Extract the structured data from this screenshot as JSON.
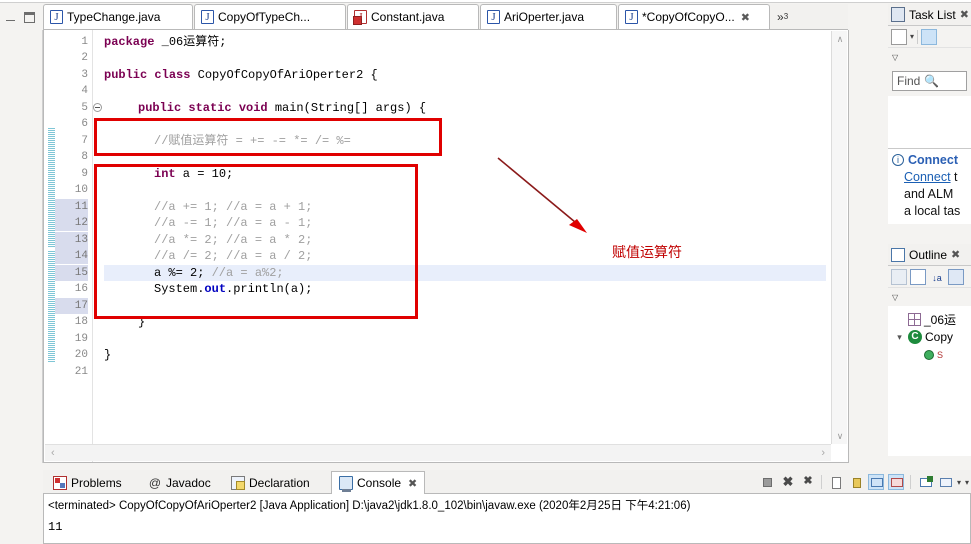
{
  "app": {
    "title": "Eclipse IDE - CopyOfCopyOfAriOperter2.java"
  },
  "editor_tabs": [
    {
      "label": "TypeChange.java",
      "icon": "java-file-icon",
      "active": false,
      "dirty": false,
      "error": false
    },
    {
      "label": "CopyOfTypeCh...",
      "icon": "java-file-icon",
      "active": false,
      "dirty": false,
      "error": false
    },
    {
      "label": "Constant.java",
      "icon": "java-file-error-icon",
      "active": false,
      "dirty": false,
      "error": true
    },
    {
      "label": "AriOperter.java",
      "icon": "java-file-icon",
      "active": false,
      "dirty": false,
      "error": false
    },
    {
      "label": "*CopyOfCopyO...",
      "icon": "java-file-icon",
      "active": true,
      "dirty": true,
      "error": false
    }
  ],
  "editor_tab_overflow": {
    "label": "»",
    "count": "3"
  },
  "window_controls": {
    "minimize": "minimize-icon",
    "maximize": "maximize-icon"
  },
  "code": {
    "line_numbers": [
      "1",
      "2",
      "3",
      "4",
      "5",
      "6",
      "7",
      "8",
      "9",
      "10",
      "11",
      "12",
      "13",
      "14",
      "15",
      "16",
      "17",
      "18",
      "19",
      "20",
      "21"
    ],
    "highlighted_line": "15",
    "lines": [
      {
        "n": "1",
        "text": "package _06运算符;"
      },
      {
        "n": "2",
        "text": ""
      },
      {
        "n": "3",
        "text": "public class CopyOfCopyOfAriOperter2 {"
      },
      {
        "n": "4",
        "text": ""
      },
      {
        "n": "5",
        "text": "    public static void main(String[] args) {"
      },
      {
        "n": "6",
        "text": ""
      },
      {
        "n": "7",
        "text": "        //赋值运算符 = += -= *= /= %="
      },
      {
        "n": "8",
        "text": ""
      },
      {
        "n": "9",
        "text": "        int a = 10;"
      },
      {
        "n": "10",
        "text": ""
      },
      {
        "n": "11",
        "text": "        //a += 1; //a = a + 1;"
      },
      {
        "n": "12",
        "text": "        //a -= 1; //a = a - 1;"
      },
      {
        "n": "13",
        "text": "        //a *= 2; //a = a * 2;"
      },
      {
        "n": "14",
        "text": "        //a /= 2; //a = a / 2;"
      },
      {
        "n": "15",
        "text": "        a %= 2; //a = a%2;"
      },
      {
        "n": "16",
        "text": "        System.out.println(a);"
      },
      {
        "n": "17",
        "text": ""
      },
      {
        "n": "18",
        "text": "    }"
      },
      {
        "n": "19",
        "text": ""
      },
      {
        "n": "20",
        "text": "}"
      },
      {
        "n": "21",
        "text": ""
      }
    ],
    "tokens": {
      "l1_kw": "package",
      "l1_rest": " _06运算符;",
      "l3_kw1": "public",
      "l3_kw2": "class",
      "l3_rest": " CopyOfCopyOfAriOperter2 {",
      "l5_kw": "public static void",
      "l5_rest": " main(String[] args) {",
      "l7_cmt": "//赋值运算符 = += -= *= /= %=",
      "l9_kw": "int",
      "l9_rest": " a = 10;",
      "l11_cmt": "//a += 1; //a = a + 1;",
      "l12_cmt": "//a -= 1; //a = a - 1;",
      "l13_cmt": "//a *= 2; //a = a * 2;",
      "l14_cmt": "//a /= 2; //a = a / 2;",
      "l15_code": "a %= 2; ",
      "l15_cmt": "//a = a%2;",
      "l16_a": "System.",
      "l16_b": "out",
      "l16_c": ".println(a);",
      "l18": "}",
      "l20": "}"
    }
  },
  "annotations": {
    "box1_label": "assignment-operator-comment-box",
    "box2_label": "assignment-operator-code-box",
    "arrow_label": "red-arrow",
    "text": "赋值运算符",
    "color": "#e00000"
  },
  "task_list": {
    "tab_label": "Task List",
    "close_icon": "✖",
    "find_placeholder": "Find",
    "search_icon": "search-icon",
    "new_task_icon": "new-task-icon",
    "categorize_icon": "categorize-icon",
    "menu_icon": "view-menu-icon",
    "connect_title": "Connect",
    "connect_link": "Connect",
    "connect_line1_rest": " t",
    "connect_line2": "and ALM",
    "connect_line3": "a local tas"
  },
  "outline": {
    "tab_label": "Outline",
    "close_icon": "✖",
    "items": [
      {
        "label": "_06运",
        "icon": "package-icon",
        "indent": 0,
        "expandable": false
      },
      {
        "label": "Copy",
        "icon": "class-icon",
        "indent": 0,
        "expandable": true,
        "expanded": true
      },
      {
        "label": "S",
        "icon": "method-icon",
        "indent": 1,
        "expandable": false
      }
    ],
    "toolbar_icons": [
      "sort-icon",
      "collapse-all-icon",
      "sort-az-icon",
      "filter-icon",
      "view-menu-icon"
    ]
  },
  "bottom_tabs": [
    {
      "label": "Problems",
      "icon": "problems-icon",
      "active": false
    },
    {
      "label": "Javadoc",
      "icon": "javadoc-icon",
      "active": false
    },
    {
      "label": "Declaration",
      "icon": "declaration-icon",
      "active": false
    },
    {
      "label": "Console",
      "icon": "console-icon",
      "active": true,
      "close_icon": "✖"
    }
  ],
  "console": {
    "status_line": "<terminated> CopyOfCopyOfAriOperter2 [Java Application] D:\\java2\\jdk1.8.0_102\\bin\\javaw.exe (2020年2月25日 下午4:21:06)",
    "output": "11",
    "toolbar_icons": [
      "terminate-icon",
      "remove-launch-icon",
      "remove-all-terminated-icon",
      "clear-console-icon",
      "scroll-lock-icon",
      "show-console-on-output-icon",
      "show-console-on-error-icon",
      "pin-console-icon",
      "display-selected-console-icon",
      "open-console-icon"
    ]
  },
  "scrollbars": {
    "v_up": "∧",
    "v_down": "∨",
    "h_left": "‹",
    "h_right": "›"
  }
}
